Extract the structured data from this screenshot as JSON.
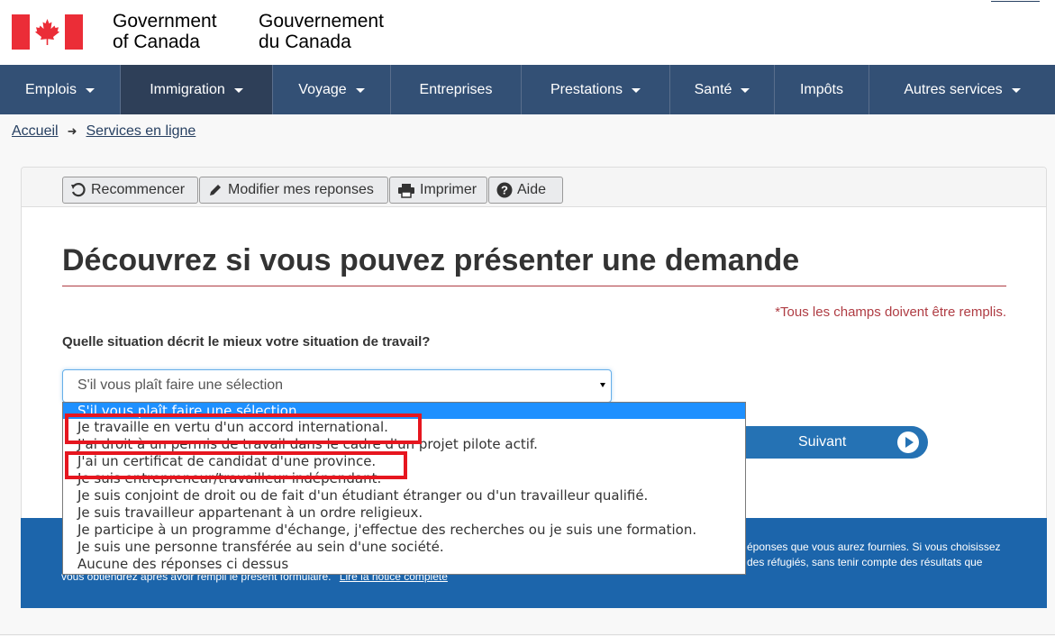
{
  "header": {
    "org_en_line1": "Government",
    "org_en_line2": "of Canada",
    "org_fr_line1": "Gouvernement",
    "org_fr_line2": "du Canada"
  },
  "menu": [
    {
      "label": "Emplois"
    },
    {
      "label": "Immigration"
    },
    {
      "label": "Voyage"
    },
    {
      "label": "Entreprises"
    },
    {
      "label": "Prestations"
    },
    {
      "label": "Santé"
    },
    {
      "label": "Impôts"
    },
    {
      "label": "Autres services"
    }
  ],
  "breadcrumb": {
    "home": "Accueil",
    "current": "Services en ligne"
  },
  "toolbar": {
    "restart": "Recommencer",
    "edit": "Modifier mes reponses",
    "print": "Imprimer",
    "help": "Aide"
  },
  "page": {
    "title": "Découvrez si vous pouvez présenter une demande",
    "required_note": "*Tous les champs doivent être remplis.",
    "question": "Quelle situation décrit le mieux votre situation de travail?",
    "select_value": "S'il vous plaît faire une sélection",
    "next_button": "Suivant"
  },
  "dropdown": {
    "options": [
      "S'il vous plaît faire une sélection",
      "Je travaille en vertu d'un accord international.",
      "J'ai droit à un permis de travail dans le cadre d'un projet pilote actif.",
      "J'ai un certificat de candidat d'une province.",
      "Je suis entrepreneur/travailleur indépendant.",
      "Je suis conjoint de droit ou de fait d'un étudiant étranger ou d'un travailleur qualifié.",
      "Je suis travailleur appartenant à un ordre religieux.",
      "Je participe à un programme d'échange, j'effectue des recherches ou je suis une formation.",
      "Je suis une personne transférée au sein d'une société.",
      "Aucune des réponses ci dessus"
    ]
  },
  "notice": {
    "line1_right": "éponses que vous aurez fournies. Si vous choisissez",
    "line2_right": "des réfugiés, sans tenir compte des résultats que",
    "line3": "vous obtiendrez après avoir rempli le présent formulaire.",
    "link": "Lire la notice complète"
  },
  "colors": {
    "menu_bg": "#335075",
    "menu_active": "#2e3f58",
    "accent_red": "#af3c43",
    "highlight_red": "#e6161f",
    "primary_blue": "#2572b4",
    "notice_blue": "#1c65ab",
    "flag_red": "#eb2d37"
  }
}
